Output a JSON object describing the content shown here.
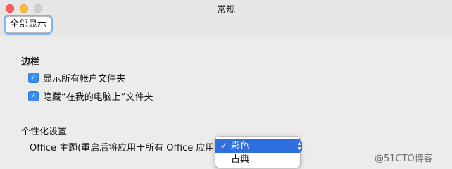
{
  "window": {
    "title": "常规"
  },
  "toolbar": {
    "show_all_label": "全部显示"
  },
  "sidebar_section": {
    "title": "边栏",
    "options": [
      {
        "label": "显示所有帐户文件夹",
        "checked": true
      },
      {
        "label": "隐藏“在我的电脑上”文件夹",
        "checked": true
      }
    ]
  },
  "personalization": {
    "title": "个性化设置",
    "theme_label": "Office 主题(重启后将应用于所有 Office 应用)",
    "theme_options": [
      {
        "label": "彩色",
        "selected": true
      },
      {
        "label": "古典",
        "selected": false
      }
    ]
  },
  "watermark": "@51CTO博客",
  "colors": {
    "accent": "#2f6fe0",
    "checkbox": "#3b8df5"
  },
  "icons": {
    "check": "checkmark-icon",
    "stepper": "stepper-icon"
  }
}
